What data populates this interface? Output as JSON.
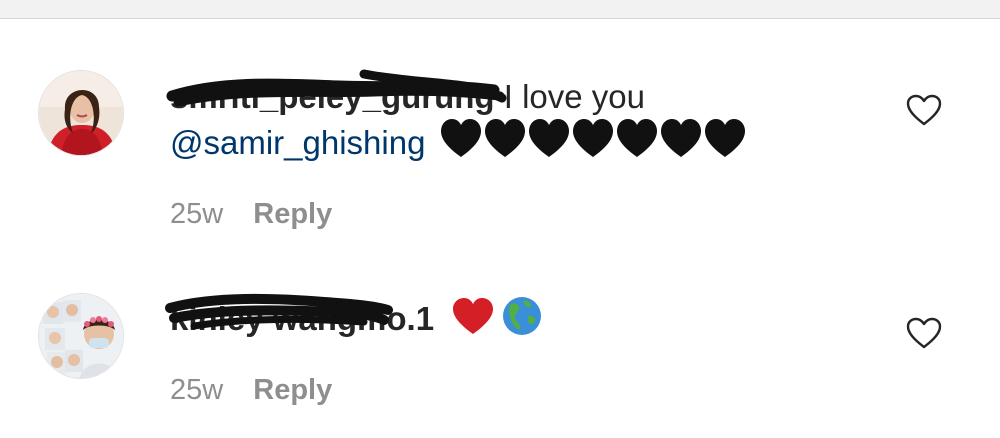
{
  "comments": [
    {
      "username": "smriti_peley_gurung",
      "text": "I love you",
      "mention": "@samir_ghishing",
      "emoji_icons": [
        "black-heart-icon",
        "black-heart-icon",
        "black-heart-icon",
        "black-heart-icon",
        "black-heart-icon",
        "black-heart-icon",
        "black-heart-icon"
      ],
      "time": "25w",
      "reply_label": "Reply"
    },
    {
      "username": "kinley wangmo.1",
      "text": "",
      "emoji_icons": [
        "red-heart-icon",
        "globe-americas-icon"
      ],
      "time": "25w",
      "reply_label": "Reply"
    }
  ],
  "colors": {
    "mention": "#00376b",
    "meta": "#8e8e8e",
    "text": "#262626"
  }
}
